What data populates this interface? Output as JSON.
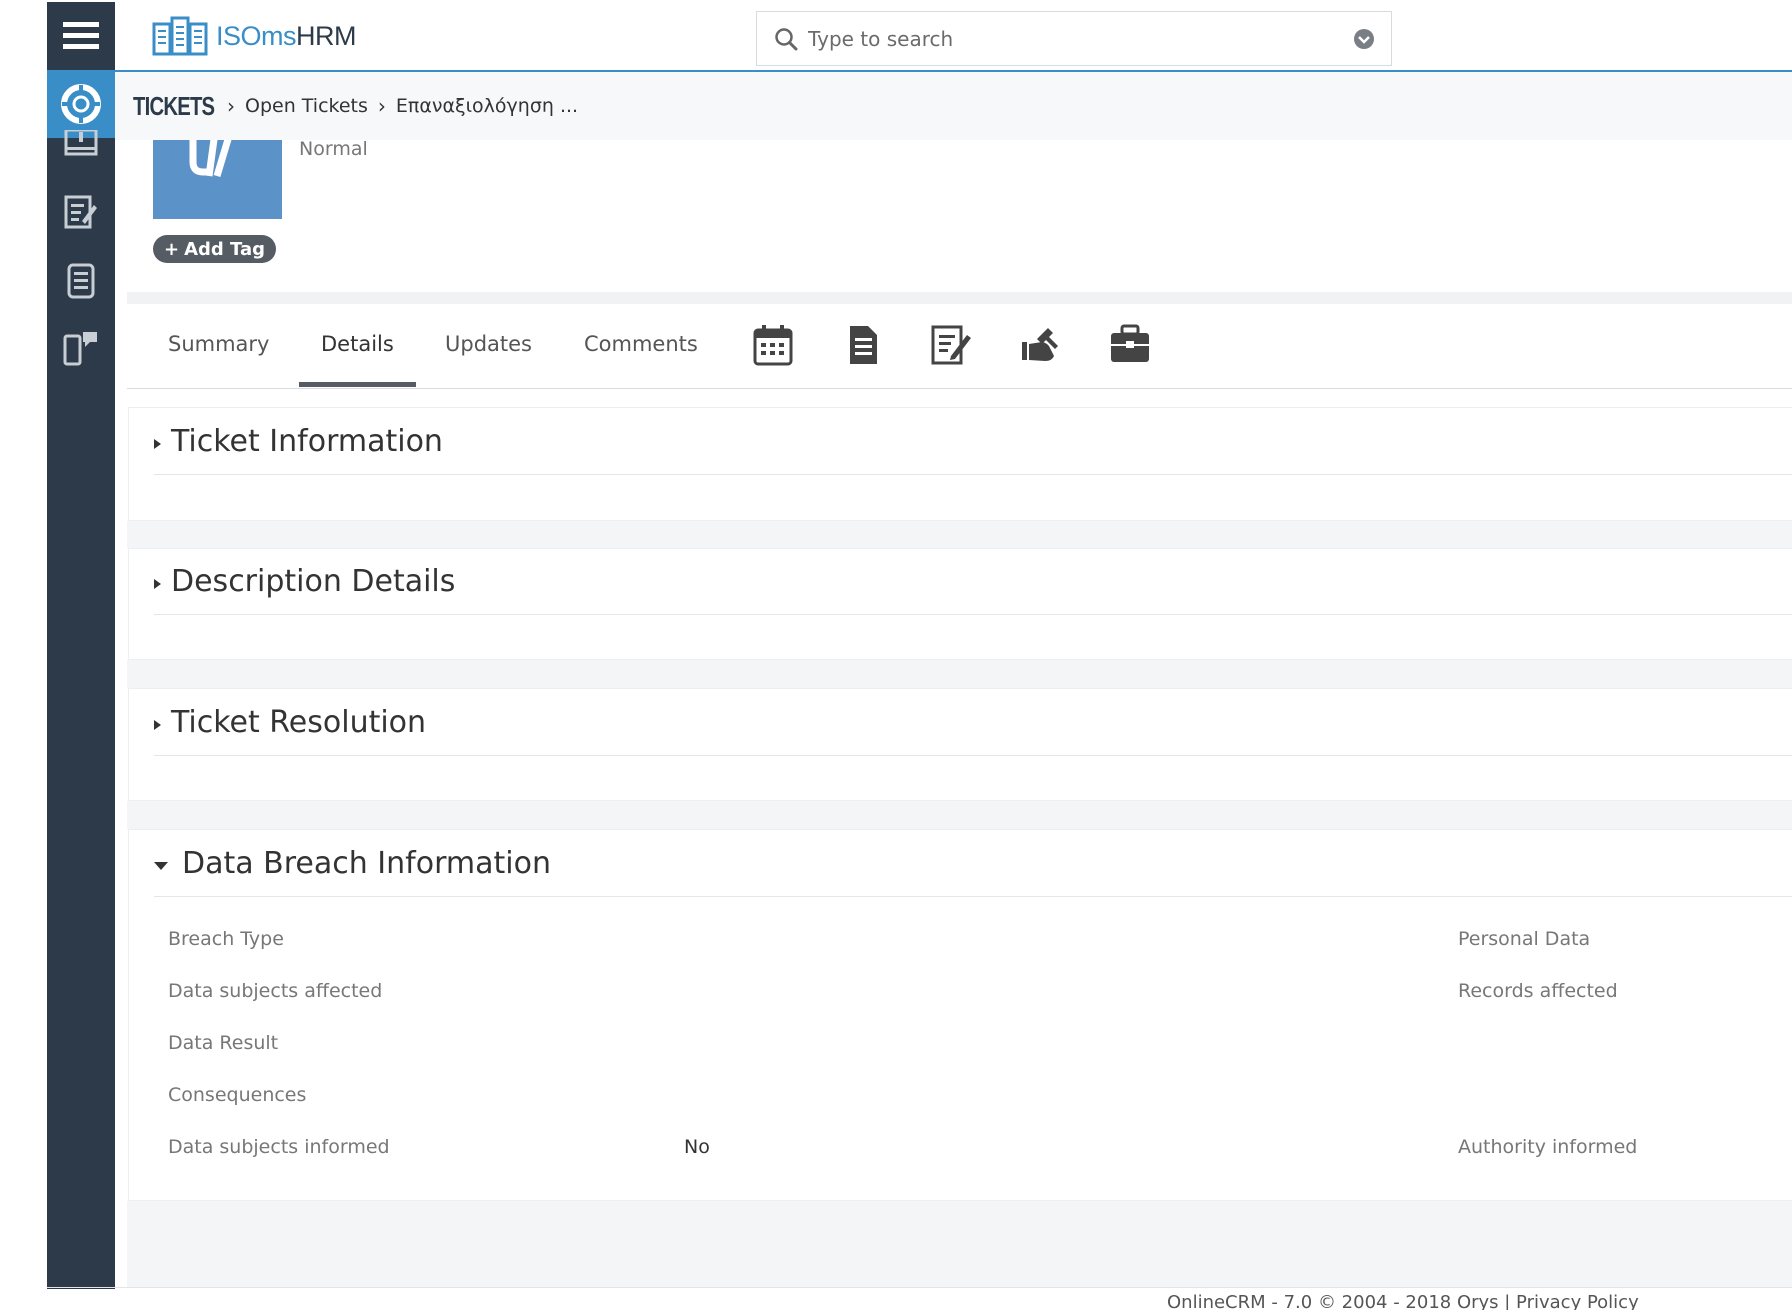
{
  "app": {
    "logo_prefix": "ISOms",
    "logo_suffix": "HRM"
  },
  "search": {
    "placeholder": "Type to search"
  },
  "breadcrumb": {
    "module": "TICKETS",
    "items": [
      "Open Tickets",
      "Επαναξιολόγηση ..."
    ]
  },
  "record": {
    "priority": "Normal",
    "add_tag_label": "Add Tag"
  },
  "tabs": [
    {
      "label": "Summary"
    },
    {
      "label": "Details"
    },
    {
      "label": "Updates"
    },
    {
      "label": "Comments"
    }
  ],
  "tab_icons": [
    "calendar-icon",
    "document-icon",
    "edit-document-icon",
    "service-hand-icon",
    "briefcase-icon"
  ],
  "sections": {
    "ticket_information": "Ticket Information",
    "description_details": "Description Details",
    "ticket_resolution": "Ticket Resolution",
    "data_breach": "Data Breach Information"
  },
  "data_breach_fields": {
    "breach_type": "Breach Type",
    "personal_data": "Personal Data",
    "data_subjects_affected": "Data subjects affected",
    "records_affected": "Records affected",
    "data_result": "Data Result",
    "consequences": "Consequences",
    "data_subjects_informed": "Data subjects informed",
    "data_subjects_informed_value": "No",
    "authority_informed": "Authority informed"
  },
  "footer": {
    "text": "OnlineCRM - 7.0 © 2004 - 2018  Orys |  Privacy Policy"
  },
  "colors": {
    "sidebar": "#2c3a4a",
    "accent": "#3a8ec7",
    "tag_button": "#555c63"
  }
}
